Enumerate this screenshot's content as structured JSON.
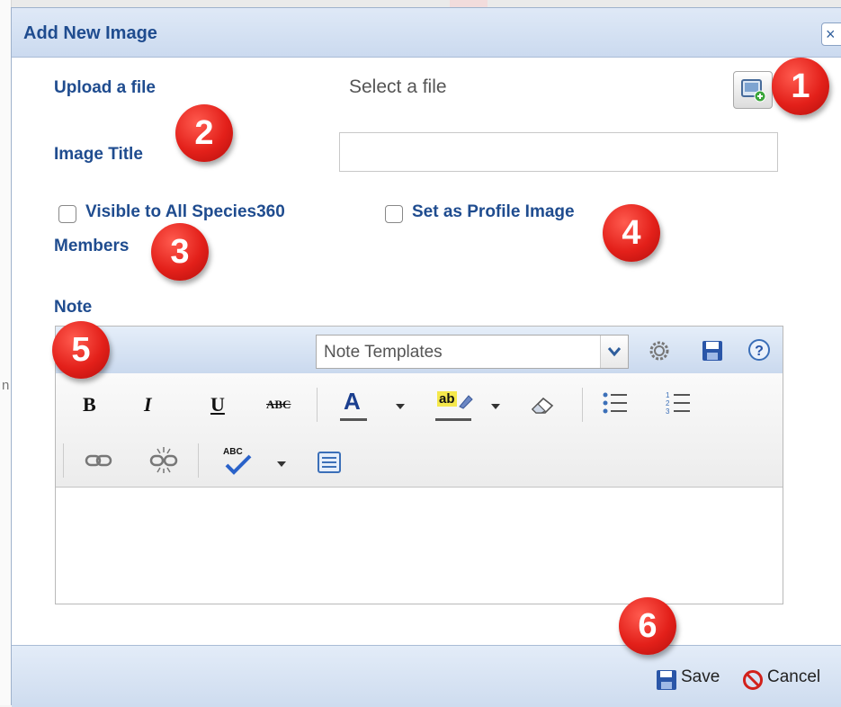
{
  "dialog": {
    "title": "Add New Image",
    "close_label": "×"
  },
  "form": {
    "upload_label": "Upload a file",
    "select_file_text": "Select a file",
    "image_title_label": "Image Title",
    "image_title_value": "",
    "visible_label_line1": "Visible to All Species360",
    "visible_label_line2": "Members",
    "visible_checked": false,
    "profile_label": "Set as Profile Image",
    "profile_checked": false,
    "note_label": "Note"
  },
  "editor": {
    "template_select_value": "Note Templates",
    "bold": "B",
    "italic": "I",
    "underline": "U",
    "strike": "ABC",
    "font_color": "A",
    "highlight": "ab",
    "spellcheck": "ABC"
  },
  "footer": {
    "save_label": "Save",
    "cancel_label": "Cancel"
  },
  "callouts": [
    "1",
    "2",
    "3",
    "4",
    "5",
    "6"
  ],
  "colors": {
    "label_blue": "#1f4c8f",
    "callout_red": "#e3201a",
    "header_blue": "#cbdaef"
  },
  "icons": {
    "file": "image-upload-icon",
    "settings": "gear-icon",
    "save": "floppy-disk-icon",
    "help": "help-icon",
    "cancel": "no-entry-icon"
  }
}
